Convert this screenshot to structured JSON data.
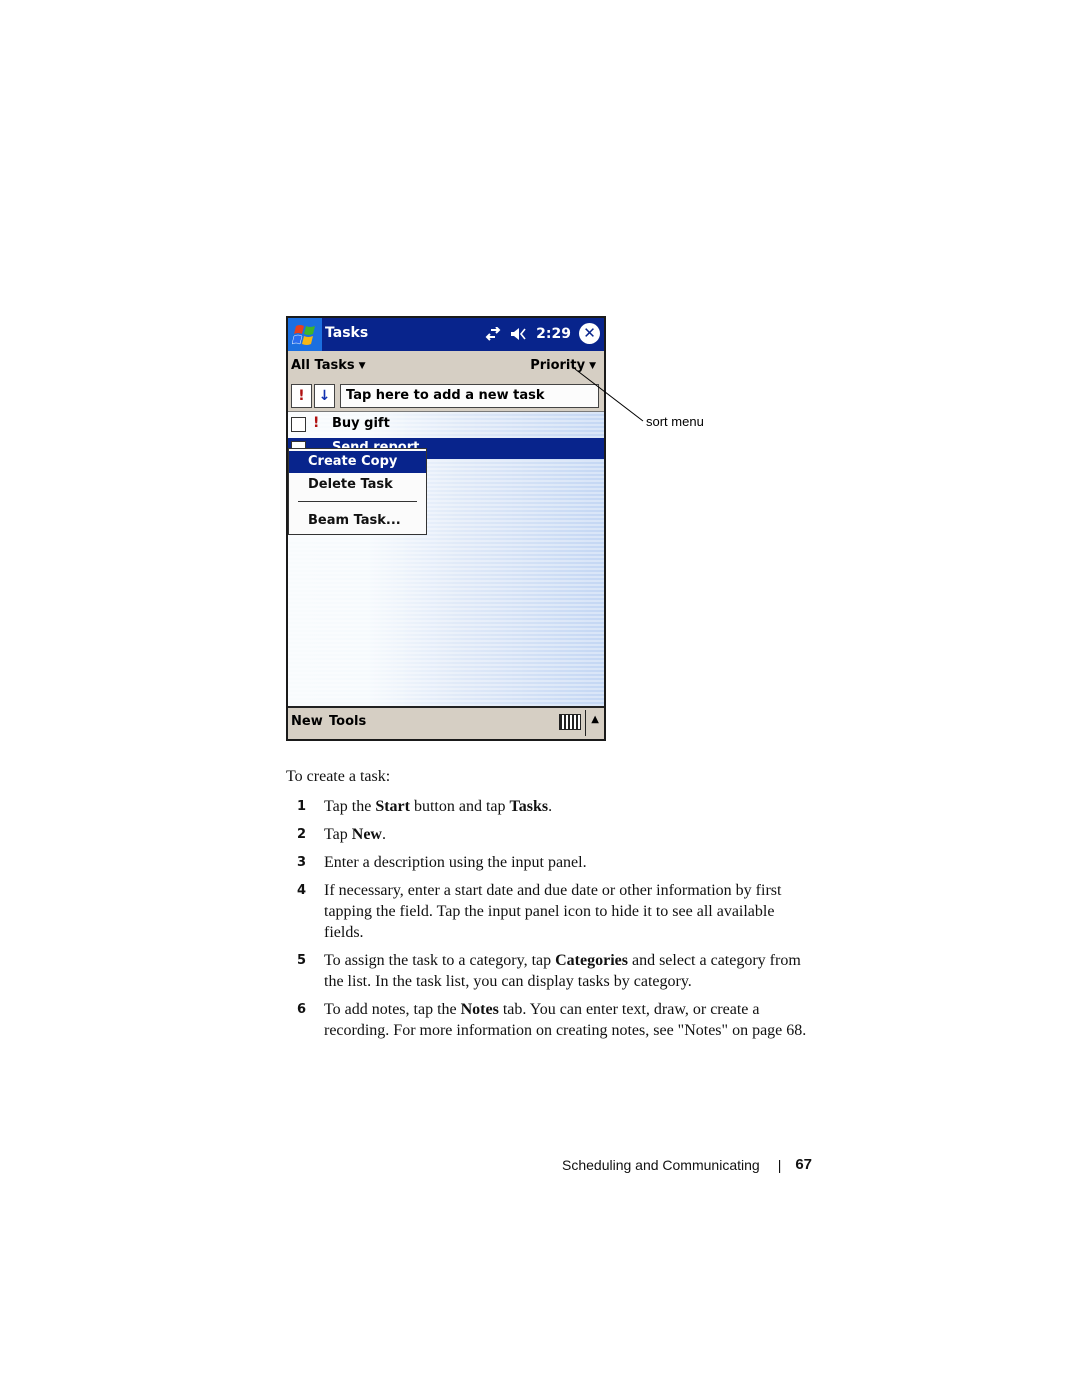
{
  "screenshot": {
    "titlebar": {
      "start_icon": "windows-flag-icon",
      "title": "Tasks",
      "connectivity_icon": "connectivity-arrows-icon",
      "volume_icon": "speaker-icon",
      "time": "2:29",
      "close_icon": "close-x-icon",
      "close_glyph": "✕"
    },
    "filterbar": {
      "category_filter": "All Tasks",
      "sort_menu": "Priority",
      "caret_glyph": "▼"
    },
    "entrybar": {
      "priority_glyph": "!",
      "sort_glyph": "↓",
      "new_task_placeholder": "Tap here to add a new task"
    },
    "tasks": [
      {
        "label": "Buy gift",
        "priority": "high",
        "priority_glyph": "!",
        "checked": false,
        "selected": false
      },
      {
        "label": "Send report",
        "priority": "normal",
        "priority_glyph": "",
        "checked": false,
        "selected": true
      }
    ],
    "context_menu": {
      "items": [
        "Create Copy",
        "Delete Task",
        "Beam Task..."
      ],
      "active_index": 0
    },
    "menubar": {
      "new_label": "New",
      "tools_label": "Tools",
      "keyboard_icon": "keyboard-icon",
      "sip_arrow_glyph": "▲"
    },
    "colors": {
      "titlebar": "#08248c",
      "selection": "#08248c",
      "chrome": "#d6cfc4",
      "priority_red": "#b01010",
      "sort_blue": "#1030b0"
    }
  },
  "callout": {
    "label": "sort menu"
  },
  "document": {
    "intro": "To create a task:",
    "steps": [
      {
        "num": "1",
        "parts": [
          {
            "t": "Tap the "
          },
          {
            "t": "Start",
            "b": true
          },
          {
            "t": " button and tap "
          },
          {
            "t": "Tasks",
            "b": true
          },
          {
            "t": "."
          }
        ]
      },
      {
        "num": "2",
        "parts": [
          {
            "t": "Tap "
          },
          {
            "t": "New",
            "b": true
          },
          {
            "t": "."
          }
        ]
      },
      {
        "num": "3",
        "parts": [
          {
            "t": "Enter a description using the input panel."
          }
        ]
      },
      {
        "num": "4",
        "parts": [
          {
            "t": "If necessary, enter a start date and due date or other information by first tapping the field. Tap the input panel icon to hide it to see all available fields."
          }
        ]
      },
      {
        "num": "5",
        "parts": [
          {
            "t": "To assign the task to a category, tap "
          },
          {
            "t": "Categories",
            "b": true
          },
          {
            "t": " and select a category from the list. In the task list, you can display tasks by category."
          }
        ]
      },
      {
        "num": "6",
        "parts": [
          {
            "t": "To add notes, tap the "
          },
          {
            "t": "Notes",
            "b": true
          },
          {
            "t": " tab. You can enter text, draw, or create a recording. For more information on creating notes, see \"Notes\" on page 68."
          }
        ]
      }
    ]
  },
  "footer": {
    "section": "Scheduling and Communicating",
    "separator": "|",
    "page_number": "67"
  }
}
